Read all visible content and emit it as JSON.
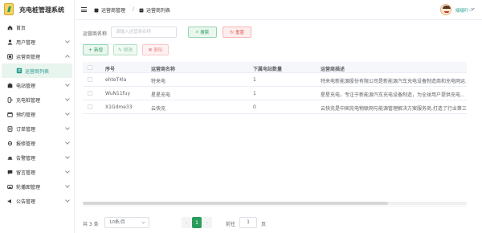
{
  "app": {
    "title": "充电桩管理系统"
  },
  "sidebar": {
    "items": [
      {
        "label": "首页",
        "icon": "home-icon"
      },
      {
        "label": "用户管理",
        "icon": "user-icon"
      },
      {
        "label": "运营商管理",
        "icon": "operator-icon",
        "expanded": true,
        "children": [
          {
            "label": "运营商列表",
            "icon": "list-icon",
            "active": true
          }
        ]
      },
      {
        "label": "电站管理",
        "icon": "station-icon"
      },
      {
        "label": "充电桩管理",
        "icon": "charger-icon"
      },
      {
        "label": "预约管理",
        "icon": "calendar-icon"
      },
      {
        "label": "订单管理",
        "icon": "order-icon"
      },
      {
        "label": "报修管理",
        "icon": "repair-icon"
      },
      {
        "label": "告警管理",
        "icon": "alarm-icon"
      },
      {
        "label": "留言管理",
        "icon": "message-icon"
      },
      {
        "label": "轮播图管理",
        "icon": "carousel-icon"
      },
      {
        "label": "公告管理",
        "icon": "notice-icon"
      }
    ]
  },
  "header": {
    "breadcrumb": [
      "运营商管理",
      "运营商列表"
    ],
    "separator": "/",
    "username": "啵啵吖~"
  },
  "search": {
    "label": "运营商名称",
    "placeholder": "请输入运营商名称",
    "search_label": "搜索",
    "reset_label": "重置"
  },
  "toolbar": {
    "add_label": "新增",
    "edit_label": "修改",
    "delete_label": "删除"
  },
  "table": {
    "columns": [
      "序号",
      "运营商名称",
      "下属电站数量",
      "运营商描述"
    ],
    "rows": [
      {
        "id": "ehteT4la",
        "name": "特来电",
        "stations": "1",
        "desc": "特来电新能源股份有限公司是新能源汽车充电设备制造商和充电网运..."
      },
      {
        "id": "WuN11fuy",
        "name": "星星充电",
        "stations": "1",
        "desc": "星星充电，专注于新能源汽车充电设备制造，为全球用户提供充电..."
      },
      {
        "id": "X1Gdme33",
        "name": "云快充",
        "stations": "0",
        "desc": "云快充是中国充电物联网与能源管理解决方案服务商,打造了行业第三..."
      }
    ]
  },
  "pagination": {
    "total_text": "共 3 条",
    "page_size": "10条/页",
    "prev": "‹",
    "next": "›",
    "current_page": "1",
    "goto_label": "前往",
    "goto_value": "1",
    "page_unit": "页"
  },
  "colors": {
    "accent": "#2a9d5c",
    "danger": "#e25555",
    "active_bg": "#e8f5ee"
  }
}
